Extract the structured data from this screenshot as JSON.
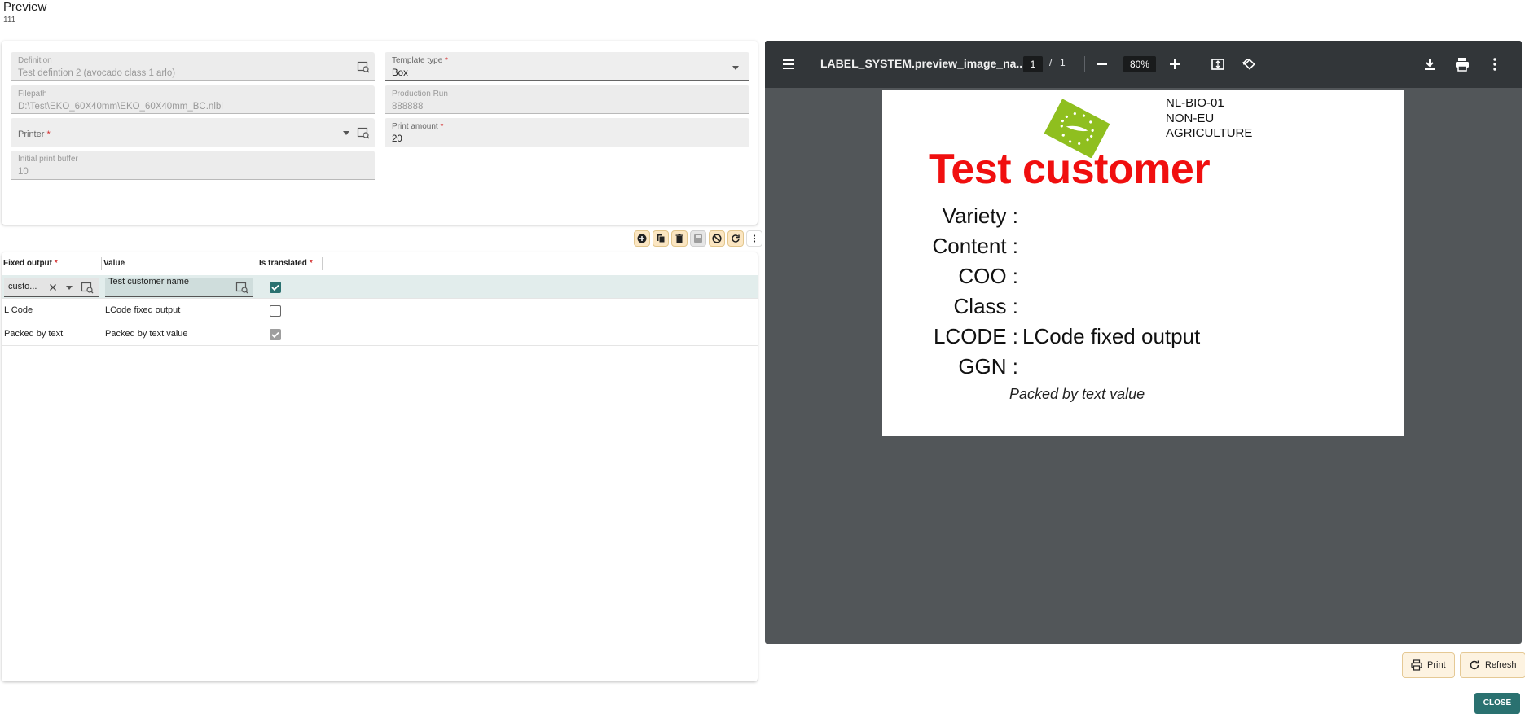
{
  "header": {
    "title": "Preview",
    "subtitle": "111"
  },
  "form": {
    "definition": {
      "label": "Definition",
      "value": "Test defintion 2 (avocado class 1 arlo)"
    },
    "template_type": {
      "label": "Template type",
      "required_mark": "*",
      "value": "Box"
    },
    "filepath": {
      "label": "Filepath",
      "value": "D:\\Test\\EKO_60X40mm\\EKO_60X40mm_BC.nlbl"
    },
    "production_run": {
      "label": "Production Run",
      "value": "888888"
    },
    "printer": {
      "label": "Printer",
      "required_mark": "*",
      "value": ""
    },
    "print_amount": {
      "label": "Print amount",
      "required_mark": "*",
      "value": "20"
    },
    "initial_print_buffer": {
      "label": "Initial print buffer",
      "value": "10"
    }
  },
  "toolbar": {
    "icons": [
      "add-icon",
      "copy-icon",
      "delete-icon",
      "save-icon",
      "cancel-icon",
      "refresh-icon",
      "more-icon"
    ]
  },
  "grid": {
    "columns": [
      {
        "label": "Fixed output",
        "required_mark": "*"
      },
      {
        "label": "Value",
        "required_mark": ""
      },
      {
        "label": "Is translated",
        "required_mark": "*"
      }
    ],
    "rows": [
      {
        "fixed_output": "custo...",
        "value": "Test customer name",
        "is_translated": true,
        "editing": true
      },
      {
        "fixed_output": "L Code",
        "value": "LCode fixed output",
        "is_translated": false,
        "editing": false
      },
      {
        "fixed_output": "Packed by text",
        "value": "Packed by text value",
        "is_translated": true,
        "editing": false
      }
    ]
  },
  "viewer": {
    "title": "LABEL_SYSTEM.preview_image_na...",
    "page_current": "1",
    "page_separator": "/",
    "page_total": "1",
    "zoom": "80%",
    "label": {
      "cert_lines": [
        "NL-BIO-01",
        "NON-EU",
        "AGRICULTURE"
      ],
      "customer": "Test customer",
      "fields": [
        {
          "label": "Variety :",
          "value": ""
        },
        {
          "label": "Content :",
          "value": ""
        },
        {
          "label": "COO :",
          "value": ""
        },
        {
          "label": "Class :",
          "value": ""
        },
        {
          "label": "LCODE :",
          "value": "LCode fixed output"
        },
        {
          "label": "GGN :",
          "value": ""
        }
      ],
      "packed_by": "Packed by text value",
      "customer_color": "#f00f0f",
      "logo_color": "#8fbf1f"
    }
  },
  "actions": {
    "print_label": "Print",
    "refresh_label": "Refresh",
    "close_label": "CLOSE"
  },
  "colors": {
    "accent": "#2a7170",
    "toolbar_button": "#fbe6c2",
    "viewer_bg": "#525659",
    "viewer_bar": "#323639"
  }
}
